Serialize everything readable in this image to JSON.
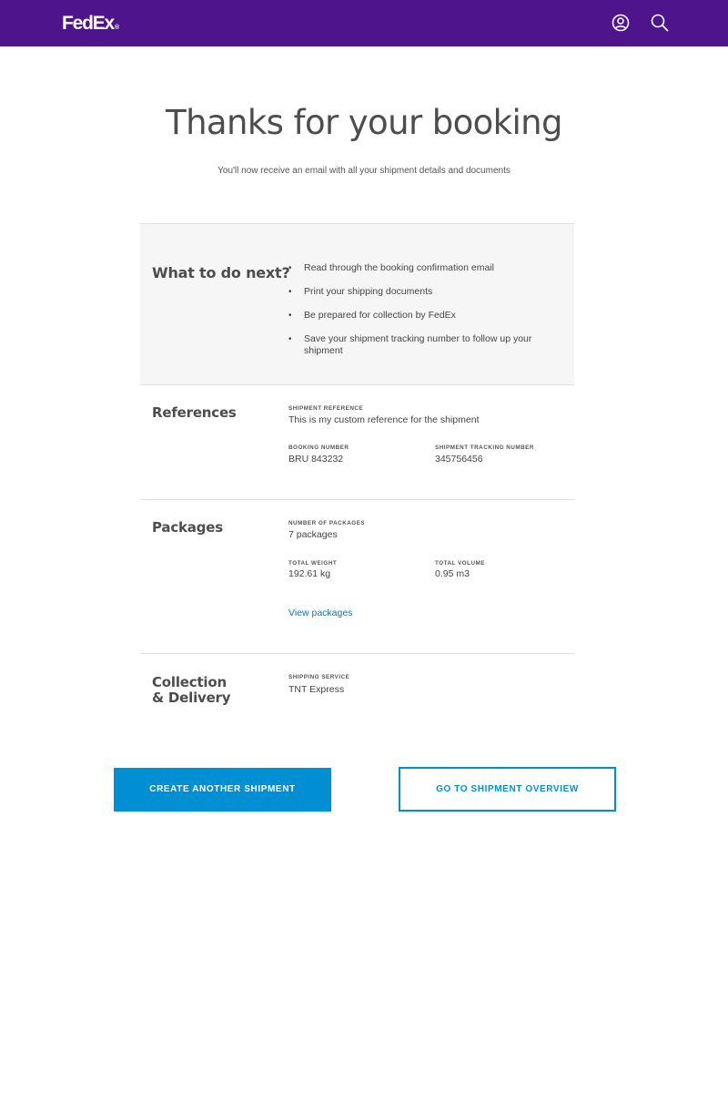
{
  "header": {
    "brand": "FedEx",
    "brand_mark": "®",
    "bg_color": "#4d148c",
    "icons": [
      "user-icon",
      "search-icon"
    ]
  },
  "main": {
    "title": "Thanks for your booking",
    "subtitle": "You'll now receive an email with all your shipment details and documents"
  },
  "next_steps": {
    "heading": "What to do next?",
    "items": [
      "Read through the booking confirmation email",
      "Print your shipping documents",
      "Be prepared for collection by FedEx",
      "Save your shipment tracking number to follow up your shipment"
    ]
  },
  "references": {
    "heading": "References",
    "shipment_reference_label": "Shipment Reference",
    "shipment_reference_value": "This is my custom reference for the shipment",
    "booking_number_label": "Booking Number",
    "booking_number_value": "BRU 843232",
    "tracking_number_label": "Shipment Tracking Number",
    "tracking_number_value": "345756456"
  },
  "packages": {
    "heading": "Packages",
    "count_label": "Number of Packages",
    "count_value": "7 packages",
    "weight_label": "Total Weight",
    "weight_value": "192.61 kg",
    "volume_label": "Total Volume",
    "volume_value": "0.95 m3",
    "view_link": "View packages"
  },
  "collection": {
    "heading_line1": "Collection",
    "heading_line2": "& Delivery",
    "service_label": "Shipping Service",
    "service_value": "TNT Express"
  },
  "actions": {
    "create_label": "Create Another Shipment",
    "overview_label": "Go to Shipment Overview",
    "accent_color": "#008fd3"
  }
}
